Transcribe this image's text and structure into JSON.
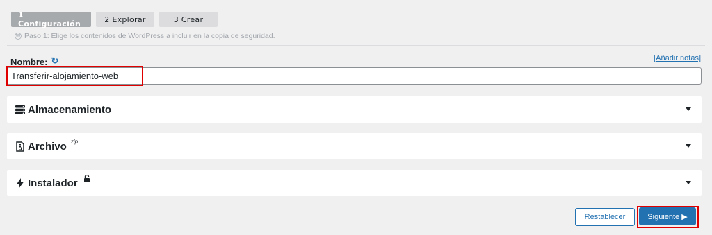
{
  "steps": [
    {
      "label": "1 Configuración"
    },
    {
      "label": "2 Explorar"
    },
    {
      "label": "3 Crear"
    }
  ],
  "step_help": "Paso 1: Elige los contenidos de WordPress a incluir en la copia de seguridad.",
  "name_field": {
    "label": "Nombre:",
    "value": "Transferir-alojamiento-web",
    "add_notes": "[Añadir notas]"
  },
  "panels": [
    {
      "title": "Almacenamiento",
      "icon": "storage-icon"
    },
    {
      "title": "Archivo",
      "sup": "zip",
      "icon": "file-zip-icon"
    },
    {
      "title": "Instalador",
      "icon": "bolt-icon",
      "badge_icon": "unlock-icon"
    }
  ],
  "buttons": {
    "reset": "Restablecer",
    "next": "Siguiente ▶"
  },
  "colors": {
    "accent": "#2271b1",
    "highlight": "#e00000",
    "background": "#f0f0f1"
  }
}
